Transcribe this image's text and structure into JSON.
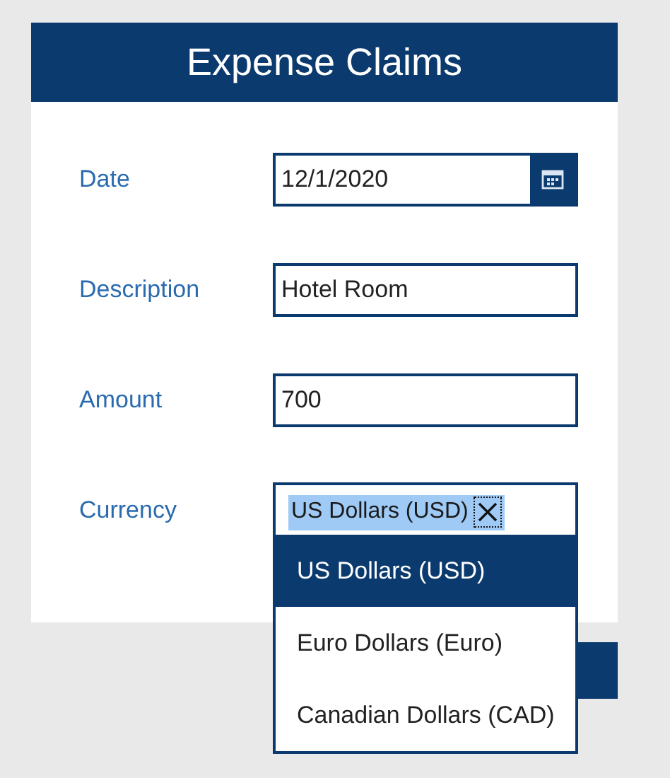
{
  "header": {
    "title": "Expense Claims"
  },
  "fields": [
    {
      "label": "Date",
      "kind": "date",
      "value": "12/1/2020"
    },
    {
      "label": "Description",
      "kind": "text",
      "value": "Hotel Room"
    },
    {
      "label": "Amount",
      "kind": "text",
      "value": "700"
    },
    {
      "label": "Currency",
      "kind": "combo",
      "value": "US Dollars (USD)",
      "expanded": true
    }
  ],
  "dropdown": {
    "options": [
      {
        "label": "US Dollars (USD)",
        "selected": true
      },
      {
        "label": "Euro Dollars (Euro)",
        "selected": false
      },
      {
        "label": "Canadian Dollars (CAD)",
        "selected": false
      }
    ]
  }
}
